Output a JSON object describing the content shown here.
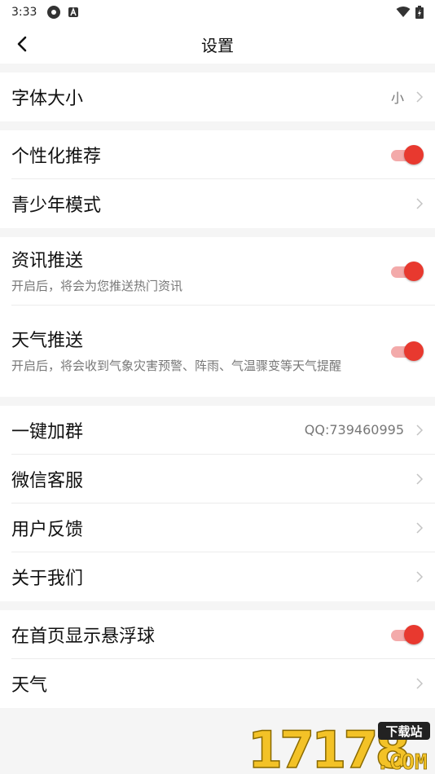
{
  "status_bar": {
    "time": "3:33"
  },
  "header": {
    "title": "设置"
  },
  "groups": [
    {
      "items": [
        {
          "label": "字体大小",
          "value": "小"
        }
      ]
    },
    {
      "items": [
        {
          "label": "个性化推荐",
          "toggle": true
        },
        {
          "label": "青少年模式"
        }
      ]
    },
    {
      "items": [
        {
          "label": "资讯推送",
          "desc": "开启后，将会为您推送热门资讯",
          "toggle": true
        },
        {
          "label": "天气推送",
          "desc": "开启后，将会收到气象灾害预警、阵雨、气温骤变等天气提醒",
          "toggle": true
        }
      ]
    },
    {
      "items": [
        {
          "label": "一键加群",
          "value": "QQ:739460995"
        },
        {
          "label": "微信客服"
        },
        {
          "label": "用户反馈"
        },
        {
          "label": "关于我们"
        }
      ]
    },
    {
      "items": [
        {
          "label": "在首页显示悬浮球",
          "toggle": true
        },
        {
          "label": "天气"
        }
      ]
    }
  ],
  "watermark": {
    "logo": "17178",
    "badge": "下载站",
    "suffix": ".COM"
  },
  "colors": {
    "accent": "#e8392f",
    "track": "#f3aaaa",
    "background": "#f5f5f5"
  }
}
